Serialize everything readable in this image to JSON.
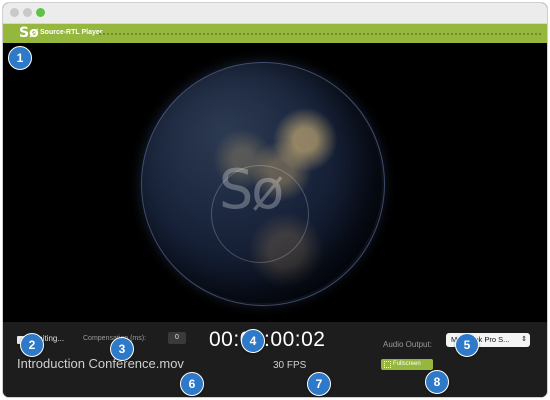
{
  "window": {
    "logo_mark": "Sø",
    "app_title": "Source-RTL Player"
  },
  "video": {
    "watermark": "Sø"
  },
  "controls": {
    "waiting_label": "Waiting...",
    "compensation_label": "Compensation (ms):",
    "compensation_value": "0",
    "timecode": "00:00:00:02",
    "audio_output_label": "Audio Output:",
    "audio_output_value": "MacBook Pro S...",
    "filename": "Introduction Conference.mov",
    "fps": "30 FPS",
    "fullscreen_label": "Fullscreen"
  },
  "annotations": [
    "1",
    "2",
    "3",
    "4",
    "5",
    "6",
    "7",
    "8"
  ],
  "colors": {
    "accent_green": "#95b73e",
    "badge_blue": "#2f79c9",
    "control_bg": "#1d1d1d"
  }
}
